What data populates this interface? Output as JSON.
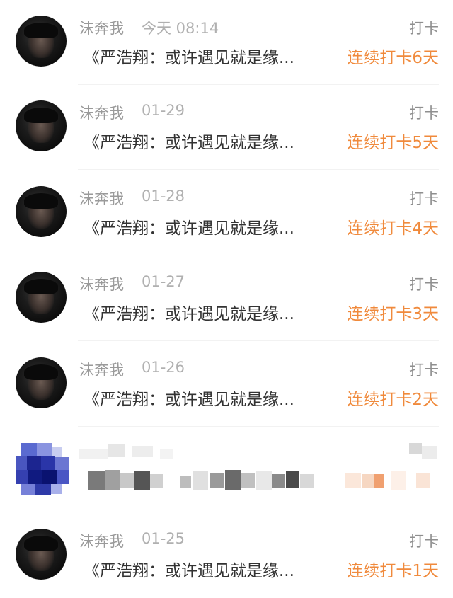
{
  "feed": {
    "items": [
      {
        "username": "沫奔我",
        "time": "今天 08:14",
        "type": "打卡",
        "content": "《严浩翔：或许遇见就是缘...",
        "streak": "连续打卡6天"
      },
      {
        "username": "沫奔我",
        "time": "01-29",
        "type": "打卡",
        "content": "《严浩翔：或许遇见就是缘...",
        "streak": "连续打卡5天"
      },
      {
        "username": "沫奔我",
        "time": "01-28",
        "type": "打卡",
        "content": "《严浩翔：或许遇见就是缘...",
        "streak": "连续打卡4天"
      },
      {
        "username": "沫奔我",
        "time": "01-27",
        "type": "打卡",
        "content": "《严浩翔：或许遇见就是缘...",
        "streak": "连续打卡3天"
      },
      {
        "username": "沫奔我",
        "time": "01-26",
        "type": "打卡",
        "content": "《严浩翔：或许遇见就是缘...",
        "streak": "连续打卡2天"
      },
      {
        "username": "沫奔我",
        "time": "01-25",
        "type": "打卡",
        "content": "《严浩翔：或许遇见就是缘...",
        "streak": "连续打卡1天"
      }
    ]
  },
  "colors": {
    "accent": "#f08a3c",
    "username": "#9a9a9a",
    "content": "#333333",
    "divider": "#f2f2f2"
  },
  "icons": {
    "avatar": "user-avatar-icon",
    "obscured_avatar": "blurred-avatar-icon"
  }
}
